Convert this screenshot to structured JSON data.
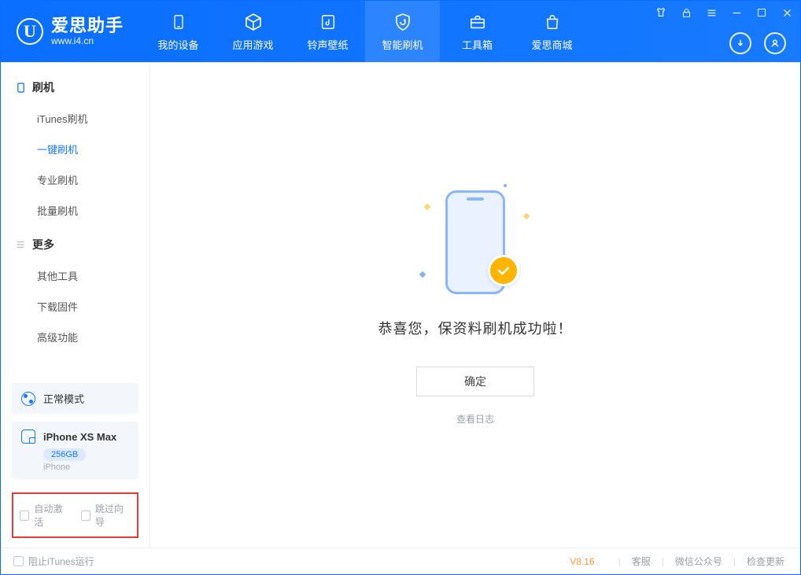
{
  "app": {
    "name": "爱思助手",
    "url": "www.i4.cn"
  },
  "nav": {
    "items": [
      {
        "label": "我的设备"
      },
      {
        "label": "应用游戏"
      },
      {
        "label": "铃声壁纸"
      },
      {
        "label": "智能刷机"
      },
      {
        "label": "工具箱"
      },
      {
        "label": "爱思商城"
      }
    ],
    "active_index": 3
  },
  "sidebar": {
    "group1_title": "刷机",
    "items1": [
      {
        "label": "iTunes刷机"
      },
      {
        "label": "一键刷机"
      },
      {
        "label": "专业刷机"
      },
      {
        "label": "批量刷机"
      }
    ],
    "active1_index": 1,
    "group2_title": "更多",
    "items2": [
      {
        "label": "其他工具"
      },
      {
        "label": "下载固件"
      },
      {
        "label": "高级功能"
      }
    ],
    "mode_label": "正常模式",
    "device": {
      "name": "iPhone XS Max",
      "capacity": "256GB",
      "type": "iPhone"
    },
    "option_auto_activate": "自动激活",
    "option_skip_guide": "跳过向导"
  },
  "main": {
    "success_message": "恭喜您，保资料刷机成功啦！",
    "ok_button": "确定",
    "view_log": "查看日志"
  },
  "footer": {
    "block_itunes": "阻止iTunes运行",
    "version": "V8.16",
    "links": [
      "客服",
      "微信公众号",
      "检查更新"
    ]
  }
}
